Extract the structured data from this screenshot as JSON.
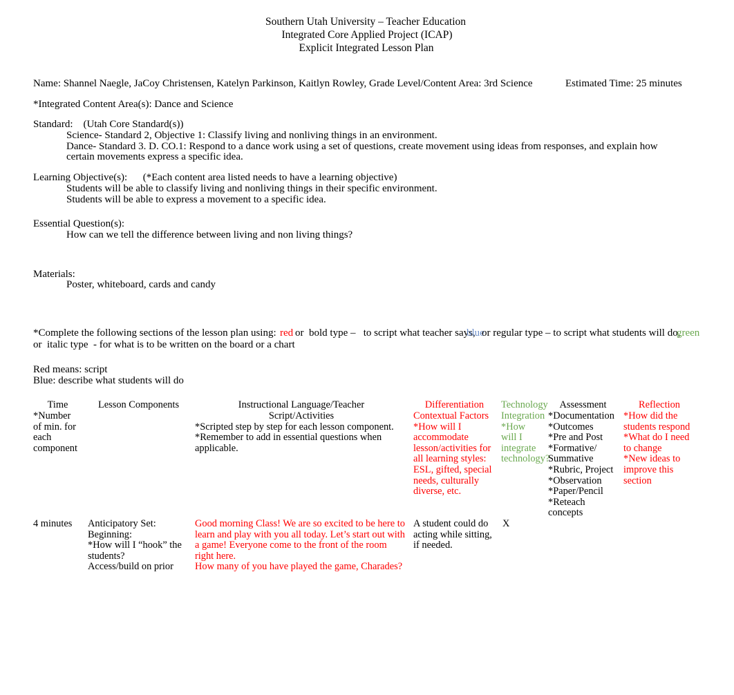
{
  "document": {
    "title_lines": [
      "Southern Utah University – Teacher Education",
      "Integrated Core Applied Project (ICAP)",
      "Explicit Integrated Lesson Plan"
    ],
    "header_fields": {
      "name": "Name: Shannel Naegle, JaCoy Christensen, Katelyn Parkinson, Kaitlyn Rowley,",
      "grade_level": "Grade Level/Content Area: 3rd Science",
      "estimated_time": "Estimated Time: 25 minutes"
    },
    "integrated_content_areas": "*Integrated Content Area(s): Dance and Science",
    "standard": {
      "label": "Standard:    (Utah Core Standard(s))",
      "items": [
        "Science- Standard 2, Objective 1: Classify living and nonliving things in an environment.",
        "Dance- Standard 3. D. CO.1: Respond to a dance work using a set of questions, create movement using ideas from responses, and explain how certain movements express a specific idea."
      ]
    },
    "learning_objectives": {
      "label": "Learning Objective(s):   (*Each content area listed needs to have a learning objective)",
      "items": [
        "Students will be able to classify living and nonliving things in their specific environment.",
        "Students will be able to express a movement to a specific idea."
      ]
    },
    "essential_questions": {
      "label": "Essential Question(s):",
      "items": [
        "How can we tell the difference between living and non living things?"
      ]
    },
    "materials": {
      "label": "Materials:",
      "items": [
        "Poster, whiteboard, cards and candy"
      ]
    },
    "color_instructions": {
      "part_a": "*Complete the following sections of the lesson plan using:",
      "red_word": "red",
      "part_b": "or  bold type –   to script what teacher says,",
      "blue_word": "blue",
      "part_c": "or regular type – to script what students will do,",
      "green_word": "green",
      "line2": "or  italic type  - for what is to be written on the board or a chart",
      "red_hex": "#ff0000",
      "blue_hex": "#6d8fc9",
      "green_hex": "#6aa84f"
    },
    "legend": {
      "red_means": "Red means: script",
      "blue_means": "Blue: describe what students will do"
    }
  },
  "table": {
    "headers": {
      "time": {
        "title": "Time",
        "lines": [
          "*Number",
          "of min. for",
          "each",
          "component"
        ]
      },
      "lesson_components": {
        "title": "Lesson Components",
        "lines": []
      },
      "instructional": {
        "title_line1": "Instructional Language/Teacher",
        "title_line2": "Script/Activities",
        "lines": [
          "*Scripted step by step for each lesson component.",
          "*Remember to add in essential questions when applicable."
        ]
      },
      "differentiation": {
        "title_line1": "Differentiation",
        "title_line2": "Contextual Factors",
        "lines": [
          "*How will I accommodate lesson/activities for all learning styles:",
          "ESL, gifted, special needs, culturally diverse, etc."
        ]
      },
      "technology": {
        "title_line1": "Technology",
        "title_line2": "Integration",
        "lines": [
          "*How will I integrate technology?"
        ]
      },
      "assessment": {
        "title": "Assessment",
        "lines": [
          "*Documentation",
          "*Outcomes",
          "*Pre and Post",
          "*Formative/ Summative",
          "*Rubric, Project",
          "*Observation",
          "*Paper/Pencil",
          "*Reteach concepts"
        ]
      },
      "reflection": {
        "title": "Reflection",
        "lines": [
          "*How did the students respond",
          "*What do I need to change",
          "*New ideas to improve this section"
        ]
      }
    },
    "rows": [
      {
        "time": "4 minutes",
        "lesson_components": [
          "Anticipatory Set:",
          "Beginning:",
          "*How will I “hook” the students?",
          "Access/build on prior"
        ],
        "instructional": [
          "Good morning Class! We are so excited to be here to learn and play with you all today. Let’s start out with a game!  Everyone come to the front of the room right here.",
          "How many of you have played the game, Charades?"
        ],
        "differentiation": [
          "A student could do acting while sitting, if needed."
        ],
        "technology": "X",
        "assessment": [],
        "reflection": []
      }
    ]
  }
}
